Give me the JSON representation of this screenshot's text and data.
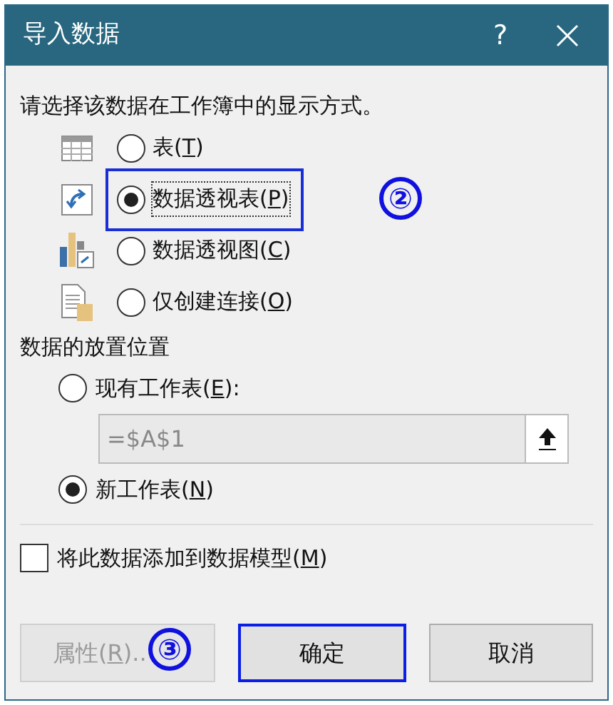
{
  "window": {
    "title": "导入数据",
    "help": "?"
  },
  "prompt": "请选择该数据在工作簿中的显示方式。",
  "view_options": [
    {
      "kind": "table",
      "label": "表(",
      "key": "T",
      "end": ")",
      "selected": false,
      "highlighted": false
    },
    {
      "kind": "pivot_table",
      "label": "数据透视表(",
      "key": "P",
      "end": ")",
      "selected": true,
      "highlighted": true
    },
    {
      "kind": "pivot_chart",
      "label": "数据透视图(",
      "key": "C",
      "end": ")",
      "selected": false,
      "highlighted": false
    },
    {
      "kind": "connection",
      "label": "仅创建连接(",
      "key": "O",
      "end": ")",
      "selected": false,
      "highlighted": false
    }
  ],
  "step_marker_1": "②",
  "placement": {
    "heading": "数据的放置位置",
    "options": [
      {
        "label": "现有工作表(",
        "key": "E",
        "end": "):",
        "selected": false
      },
      {
        "label": "新工作表(",
        "key": "N",
        "end": ")",
        "selected": true
      }
    ],
    "cell_reference": "=$A$1"
  },
  "data_model": {
    "label": "将此数据添加到数据模型(",
    "key": "M",
    "end": ")",
    "checked": false
  },
  "buttons": [
    {
      "label": "属性(",
      "key": "R",
      "end": ")..",
      "disabled": true,
      "default": false
    },
    {
      "label": "确定",
      "disabled": false,
      "default": true
    },
    {
      "label": "取消",
      "disabled": false,
      "default": false
    }
  ],
  "step_marker_2": "③"
}
